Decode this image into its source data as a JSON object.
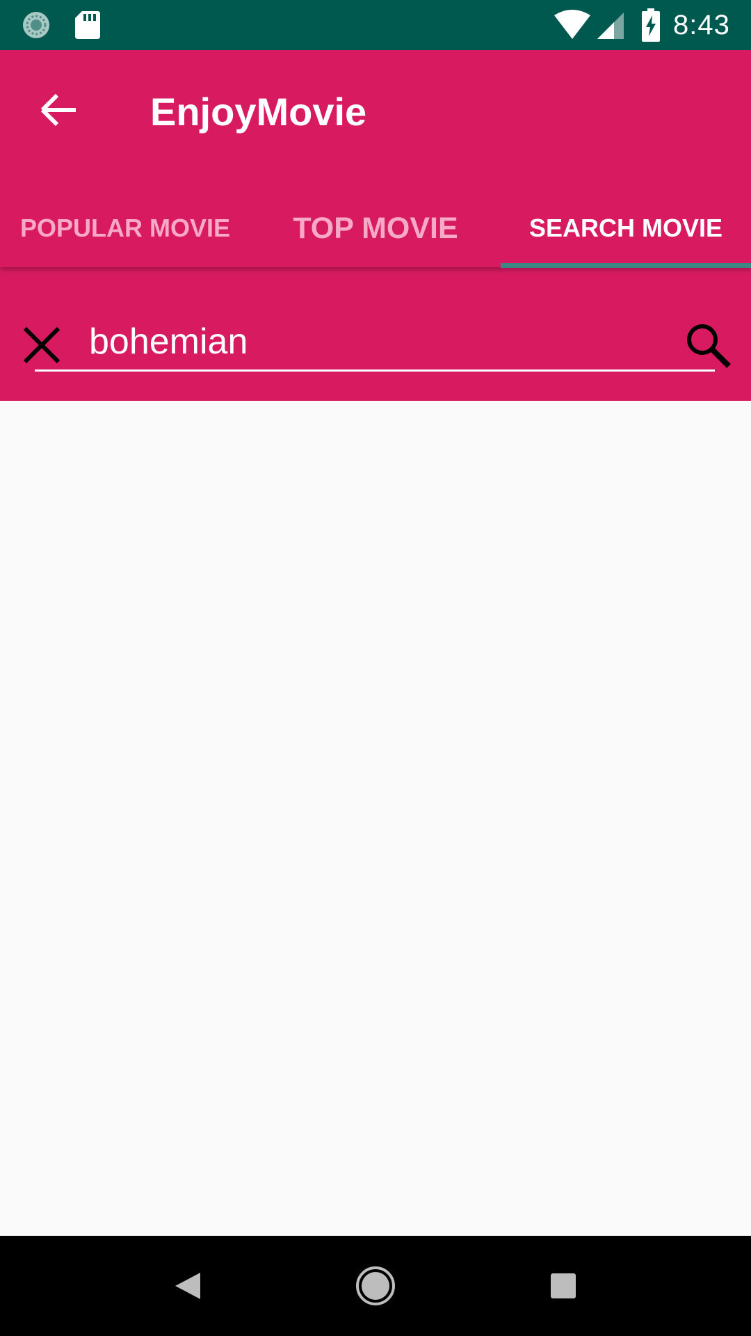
{
  "status_bar": {
    "time": "8:43",
    "icons": [
      "sync-icon",
      "sd-card-icon",
      "wifi-icon",
      "cell-signal-icon",
      "battery-charging-icon"
    ]
  },
  "app_bar": {
    "title": "EnjoyMovie",
    "back_icon": "arrow-back-icon"
  },
  "tabs": [
    {
      "label": "POPULAR MOVIE",
      "selected": false
    },
    {
      "label": "TOP MOVIE",
      "selected": false
    },
    {
      "label": "SEARCH MOVIE",
      "selected": true
    }
  ],
  "search": {
    "value": "bohemian",
    "clear_icon": "close-icon",
    "submit_icon": "search-icon"
  },
  "nav_bar": {
    "icons": [
      "nav-back-icon",
      "nav-home-icon",
      "nav-recents-icon"
    ]
  },
  "colors": {
    "primary": "#d81b60",
    "status_bar": "#00594f",
    "tab_indicator": "#3e8686",
    "background": "#fafafa",
    "inactive_tab_text": "#f8a9c6"
  }
}
